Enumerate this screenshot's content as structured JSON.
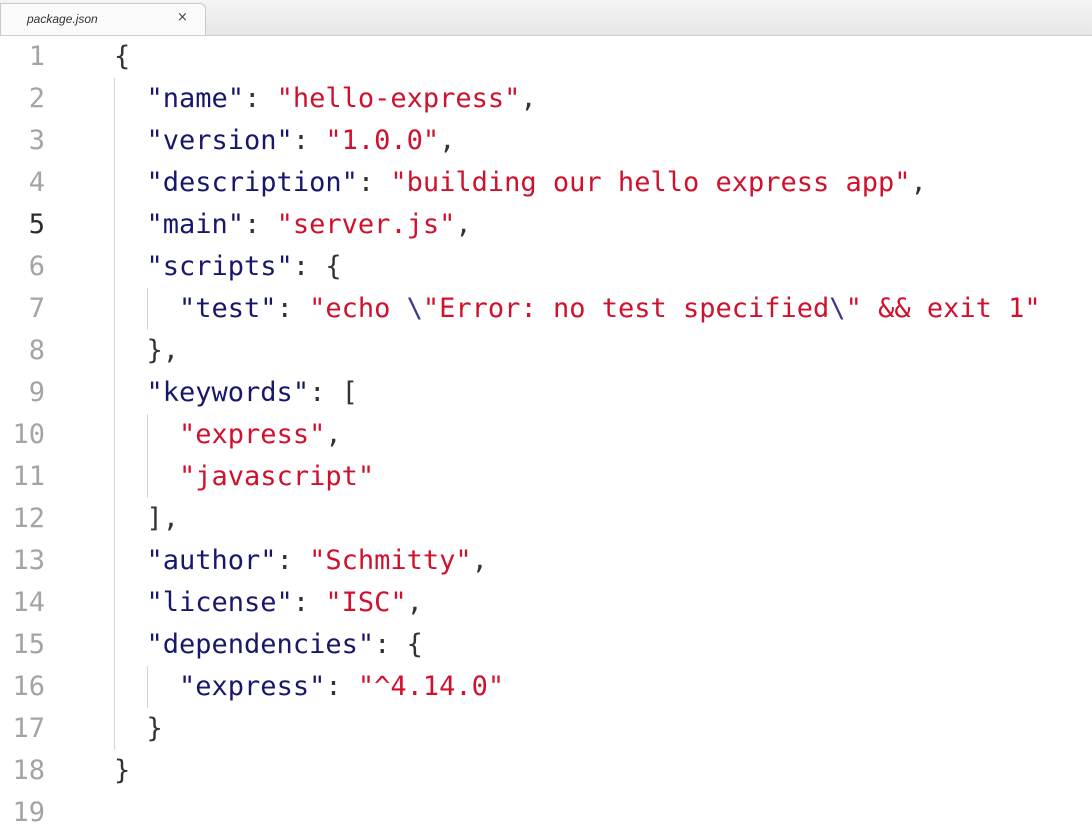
{
  "tab": {
    "title": "package.json",
    "close_glyph": "×"
  },
  "line_numbers": [
    "1",
    "2",
    "3",
    "4",
    "5",
    "6",
    "7",
    "8",
    "9",
    "10",
    "11",
    "12",
    "13",
    "14",
    "15",
    "16",
    "17",
    "18",
    "19"
  ],
  "current_line": "5",
  "code": {
    "l1": {
      "open": "{"
    },
    "l2": {
      "key": "\"name\"",
      "sep": ": ",
      "val": "\"hello-express\"",
      "end": ","
    },
    "l3": {
      "key": "\"version\"",
      "sep": ": ",
      "val": "\"1.0.0\"",
      "end": ","
    },
    "l4": {
      "key": "\"description\"",
      "sep": ": ",
      "val": "\"building our hello express app\"",
      "end": ","
    },
    "l5": {
      "key": "\"main\"",
      "sep": ": ",
      "val": "\"server.js\"",
      "end": ","
    },
    "l6": {
      "key": "\"scripts\"",
      "sep": ": ",
      "open": "{"
    },
    "l7": {
      "key": "\"test\"",
      "sep": ": ",
      "val_a": "\"echo ",
      "esc_a": "\\",
      "val_b": "\"Error: no test specified",
      "esc_b": "\\",
      "val_c": "\" && exit 1\""
    },
    "l8": {
      "close": "},"
    },
    "l9": {
      "key": "\"keywords\"",
      "sep": ": ",
      "open": "["
    },
    "l10": {
      "val": "\"express\"",
      "end": ","
    },
    "l11": {
      "val": "\"javascript\""
    },
    "l12": {
      "close": "],"
    },
    "l13": {
      "key": "\"author\"",
      "sep": ": ",
      "val": "\"Schmitty\"",
      "end": ","
    },
    "l14": {
      "key": "\"license\"",
      "sep": ": ",
      "val": "\"ISC\"",
      "end": ","
    },
    "l15": {
      "key": "\"dependencies\"",
      "sep": ": ",
      "open": "{"
    },
    "l16": {
      "key": "\"express\"",
      "sep": ": ",
      "val": "\"^4.14.0\""
    },
    "l17": {
      "close": "}"
    },
    "l18": {
      "close": "}"
    },
    "l19": {}
  },
  "colors": {
    "key": "#17186b",
    "string": "#d0112d",
    "punctuation": "#333333",
    "line_number": "#a4a4a4"
  }
}
